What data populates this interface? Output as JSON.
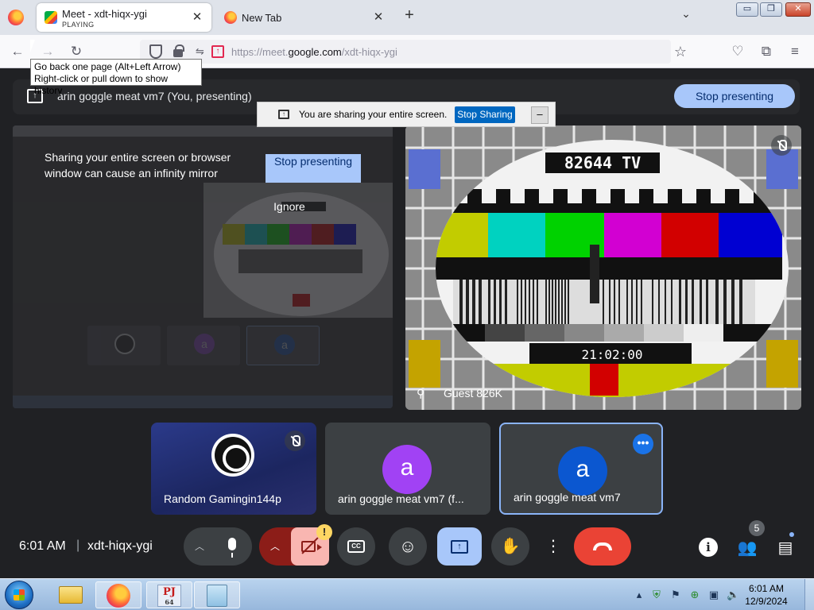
{
  "browser": {
    "tabs": [
      {
        "title": "Meet - xdt-hiqx-ygi",
        "subtitle": "PLAYING",
        "close": "✕"
      },
      {
        "title": "New Tab",
        "close": "✕"
      }
    ],
    "new_tab": "+",
    "tab_list": "⌄",
    "win_min": "▭",
    "win_max": "❐",
    "win_close": "✕",
    "url_prefix": "https://meet.",
    "url_domain": "google.com",
    "url_path": "/xdt-hiqx-ygi",
    "tooltip_line1": "Go back one page (Alt+Left Arrow)",
    "tooltip_line2": "Right-click or pull down to show history"
  },
  "meet": {
    "presenting_text": "arin goggle meat vm7 (You, presenting)",
    "stop_presenting": "Stop presenting",
    "share_notice": {
      "text": "You are sharing your entire screen.",
      "stop": "Stop Sharing",
      "minimize": "–"
    },
    "mirror_warning": {
      "text": "Sharing your entire screen or browser window can cause an infinity mirror",
      "stop": "Stop presenting",
      "ignore": "Ignore"
    },
    "guest": {
      "name": "Guest 826K",
      "tv_label": "82644 TV",
      "tv_time": "21:02:00"
    },
    "participants": [
      {
        "name": "Random Gamingin144p"
      },
      {
        "name": "arin goggle meat vm7 (f...",
        "initial": "a",
        "color": "#a142f4"
      },
      {
        "name": "arin goggle meat vm7",
        "initial": "a",
        "color": "#0b57d0"
      }
    ],
    "time": "6:01 AM",
    "meeting_code": "xdt-hiqx-ygi",
    "people_count": "5",
    "warning_badge": "!"
  },
  "taskbar": {
    "pj_label": "PJ",
    "pj_sub": "64",
    "time": "6:01 AM",
    "date": "12/9/2024"
  }
}
